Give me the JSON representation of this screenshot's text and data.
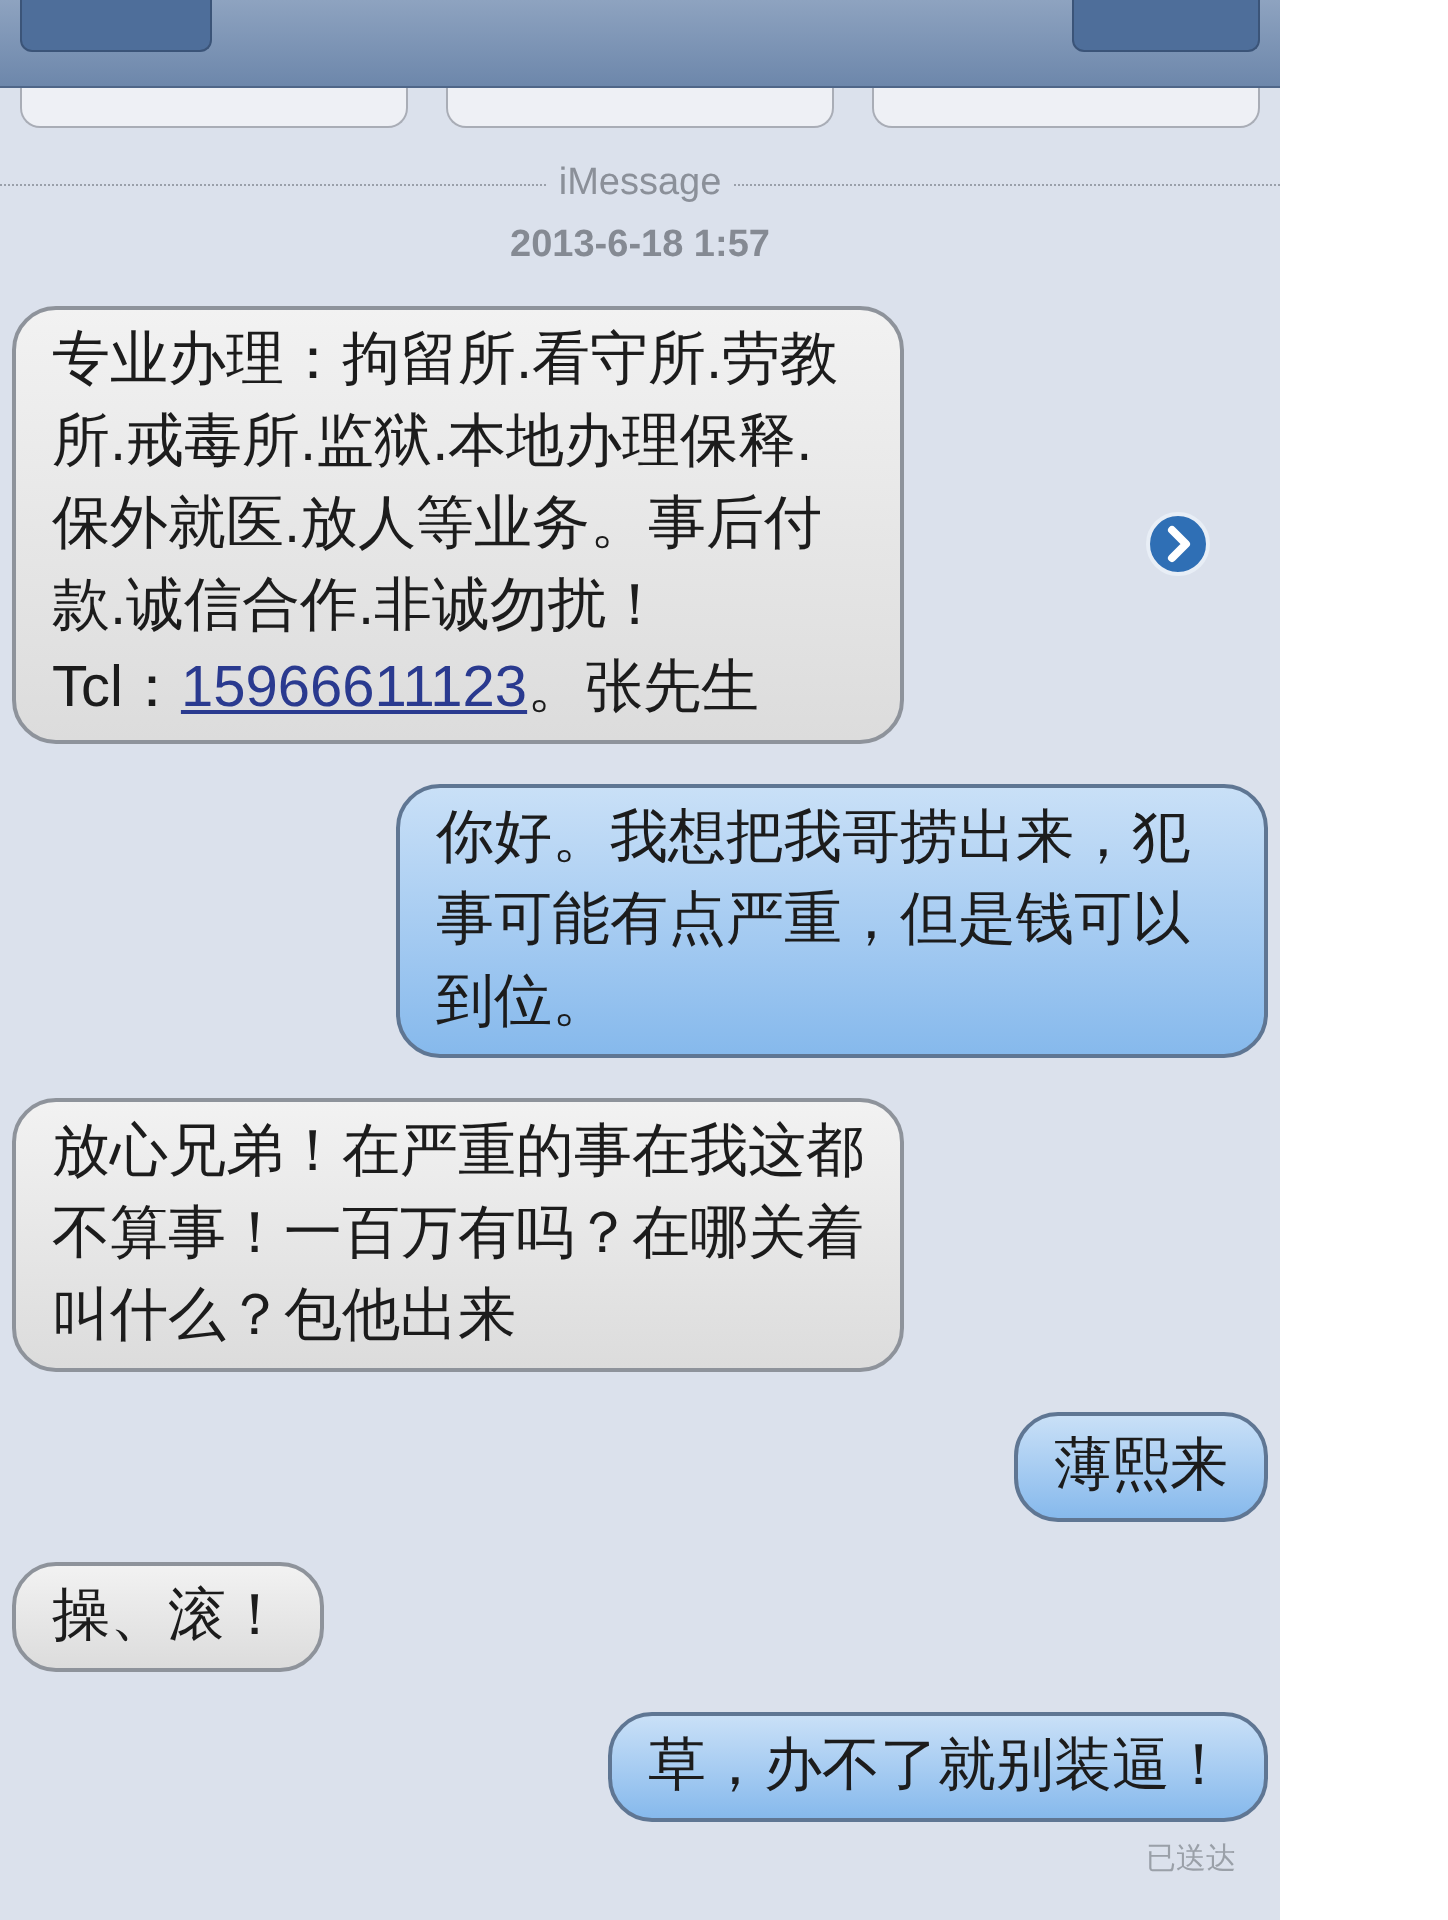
{
  "separator": {
    "label": "iMessage"
  },
  "timestamp": "2013-6-18 1:57",
  "messages": [
    {
      "kind": "incoming",
      "segments": [
        {
          "kind": "text",
          "text": "专业办理：拘留所.看守所.劳教所.戒毒所.监狱.本地办理保释.保外就医.放人等业务。事后付款.诚信合作.非诚勿扰！"
        },
        {
          "kind": "break"
        },
        {
          "kind": "text",
          "text": "Tcl："
        },
        {
          "kind": "link",
          "text": "15966611123"
        },
        {
          "kind": "text",
          "text": "。张先生"
        }
      ]
    },
    {
      "kind": "outgoing",
      "segments": [
        {
          "kind": "text",
          "text": "你好。我想把我哥捞出来，犯事可能有点严重，但是钱可以到位。"
        }
      ]
    },
    {
      "kind": "incoming",
      "segments": [
        {
          "kind": "text",
          "text": "放心兄弟！在严重的事在我这都不算事！一百万有吗？在哪关着叫什么？包他出来"
        }
      ]
    },
    {
      "kind": "outgoing",
      "segments": [
        {
          "kind": "text",
          "text": "薄熙来"
        }
      ]
    },
    {
      "kind": "incoming",
      "segments": [
        {
          "kind": "text",
          "text": "操、滚！"
        }
      ]
    },
    {
      "kind": "outgoing",
      "segments": [
        {
          "kind": "text",
          "text": "草，办不了就别装逼！"
        }
      ]
    }
  ],
  "delivery_status": "已送达"
}
